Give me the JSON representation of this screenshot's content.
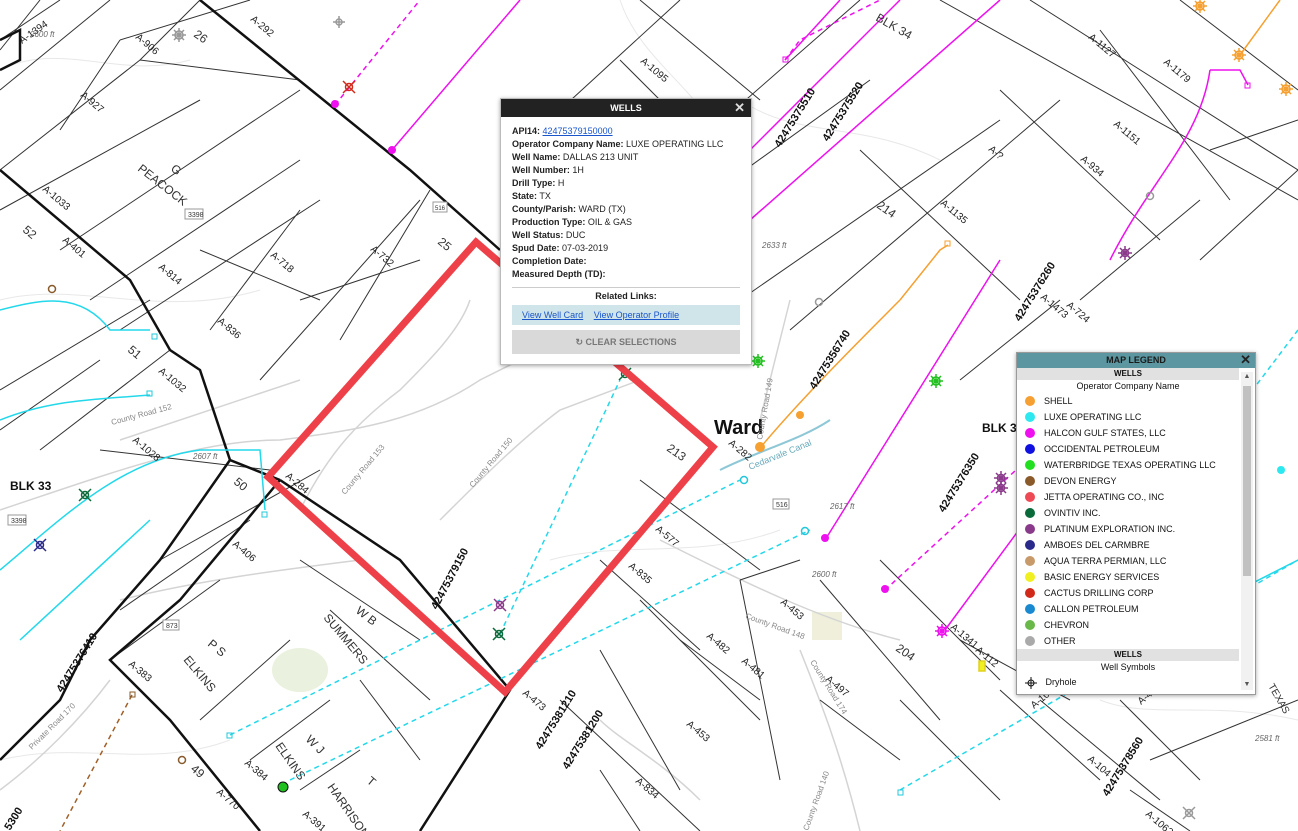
{
  "map": {
    "town_label": "Ward",
    "canal_label": "Cedarvale Canal",
    "block_labels": [
      "BLK 33",
      "BLK 34",
      "BLK 3",
      "TEXAS"
    ],
    "survey_numbers": [
      "26",
      "52",
      "51",
      "50",
      "25",
      "214",
      "213",
      "204",
      "49",
      "G",
      "PEACOCK",
      "W B",
      "SUMMERS",
      "P S",
      "ELKINS",
      "W J",
      "ELKINS",
      "T",
      "HARRISON"
    ],
    "abstracts": [
      "A-1394",
      "A-906",
      "A-292",
      "A-927",
      "A-1033",
      "A-401",
      "A-814",
      "A-718",
      "A-732",
      "A-836",
      "A-1032",
      "A-1028",
      "A-284",
      "A-406",
      "A-383",
      "A-384",
      "A-770",
      "A-391",
      "A-473",
      "A-835",
      "A-577",
      "A-482",
      "A-481",
      "A-453",
      "A-453",
      "A-834",
      "A-497",
      "A-1341",
      "A-112",
      "A-1001",
      "A-417",
      "A-1095",
      "A-1127",
      "A-1179",
      "A-1151",
      "A-934",
      "A-?",
      "A-1135",
      "A-1473",
      "A-724",
      "A-282",
      "A-1062",
      "A-104"
    ],
    "road_labels": [
      "County Road 152",
      "County Road 153",
      "County Road 150",
      "County Road 148",
      "County Road 174",
      "Private Road 170",
      "County Road 149",
      "County Road 140"
    ],
    "elevations": [
      "2600 ft",
      "2607 ft",
      "2633 ft",
      "2617 ft",
      "2600 ft",
      "2581 ft"
    ],
    "shields": [
      "3398",
      "3398",
      "873",
      "516",
      "516"
    ],
    "api_labels": [
      "42475379150",
      "42475376410",
      "42475381210",
      "42475381200",
      "42475375510",
      "42475375520",
      "42475376260",
      "42475356740",
      "42475376350",
      "42475378560",
      "5300"
    ]
  },
  "popup": {
    "title": "WELLS",
    "close": "✕",
    "api_label": "API14:",
    "api_value": "42475379150000",
    "rows": [
      {
        "label": "Operator Company Name:",
        "value": "LUXE OPERATING LLC"
      },
      {
        "label": "Well Name:",
        "value": "DALLAS 213 UNIT"
      },
      {
        "label": "Well Number:",
        "value": "1H"
      },
      {
        "label": "Drill Type:",
        "value": "H"
      },
      {
        "label": "State:",
        "value": "TX"
      },
      {
        "label": "County/Parish:",
        "value": "WARD (TX)"
      },
      {
        "label": "Production Type:",
        "value": "OIL & GAS"
      },
      {
        "label": "Well Status:",
        "value": "DUC"
      },
      {
        "label": "Spud Date:",
        "value": "07-03-2019"
      },
      {
        "label": "Completion Date:",
        "value": ""
      },
      {
        "label": "Measured Depth (TD):",
        "value": ""
      }
    ],
    "related_title": "Related Links:",
    "link_well_card": "View Well Card",
    "link_operator": "View Operator Profile",
    "clear_label": "CLEAR SELECTIONS"
  },
  "legend": {
    "title": "MAP LEGEND",
    "close": "✕",
    "section1": "WELLS",
    "subtitle1": "Operator Company Name",
    "operators": [
      {
        "name": "SHELL",
        "color": "#f5a030"
      },
      {
        "name": "LUXE OPERATING LLC",
        "color": "#2ee8f0"
      },
      {
        "name": "HALCON GULF STATES, LLC",
        "color": "#ee10ee"
      },
      {
        "name": "OCCIDENTAL PETROLEUM",
        "color": "#1010e0"
      },
      {
        "name": "WATERBRIDGE TEXAS OPERATING LLC",
        "color": "#22e020"
      },
      {
        "name": "DEVON ENERGY",
        "color": "#8a5a2a"
      },
      {
        "name": "JETTA OPERATING CO., INC",
        "color": "#ee4a55"
      },
      {
        "name": "OVINTIV INC.",
        "color": "#0a6a3a"
      },
      {
        "name": "PLATINUM EXPLORATION INC.",
        "color": "#8a3a8a"
      },
      {
        "name": "AMBOES DEL CARMBRE",
        "color": "#2a2a8a"
      },
      {
        "name": "AQUA TERRA PERMIAN, LLC",
        "color": "#c89a6a"
      },
      {
        "name": "BASIC ENERGY SERVICES",
        "color": "#f0f020"
      },
      {
        "name": "CACTUS DRILLING CORP",
        "color": "#d22a1a"
      },
      {
        "name": "CALLON PETROLEUM",
        "color": "#1a8ad0"
      },
      {
        "name": "CHEVRON",
        "color": "#6ab84a"
      },
      {
        "name": "OTHER",
        "color": "#aaaaaa"
      }
    ],
    "section2": "WELLS",
    "subtitle2": "Well Symbols",
    "symbol_first": "Dryhole"
  }
}
